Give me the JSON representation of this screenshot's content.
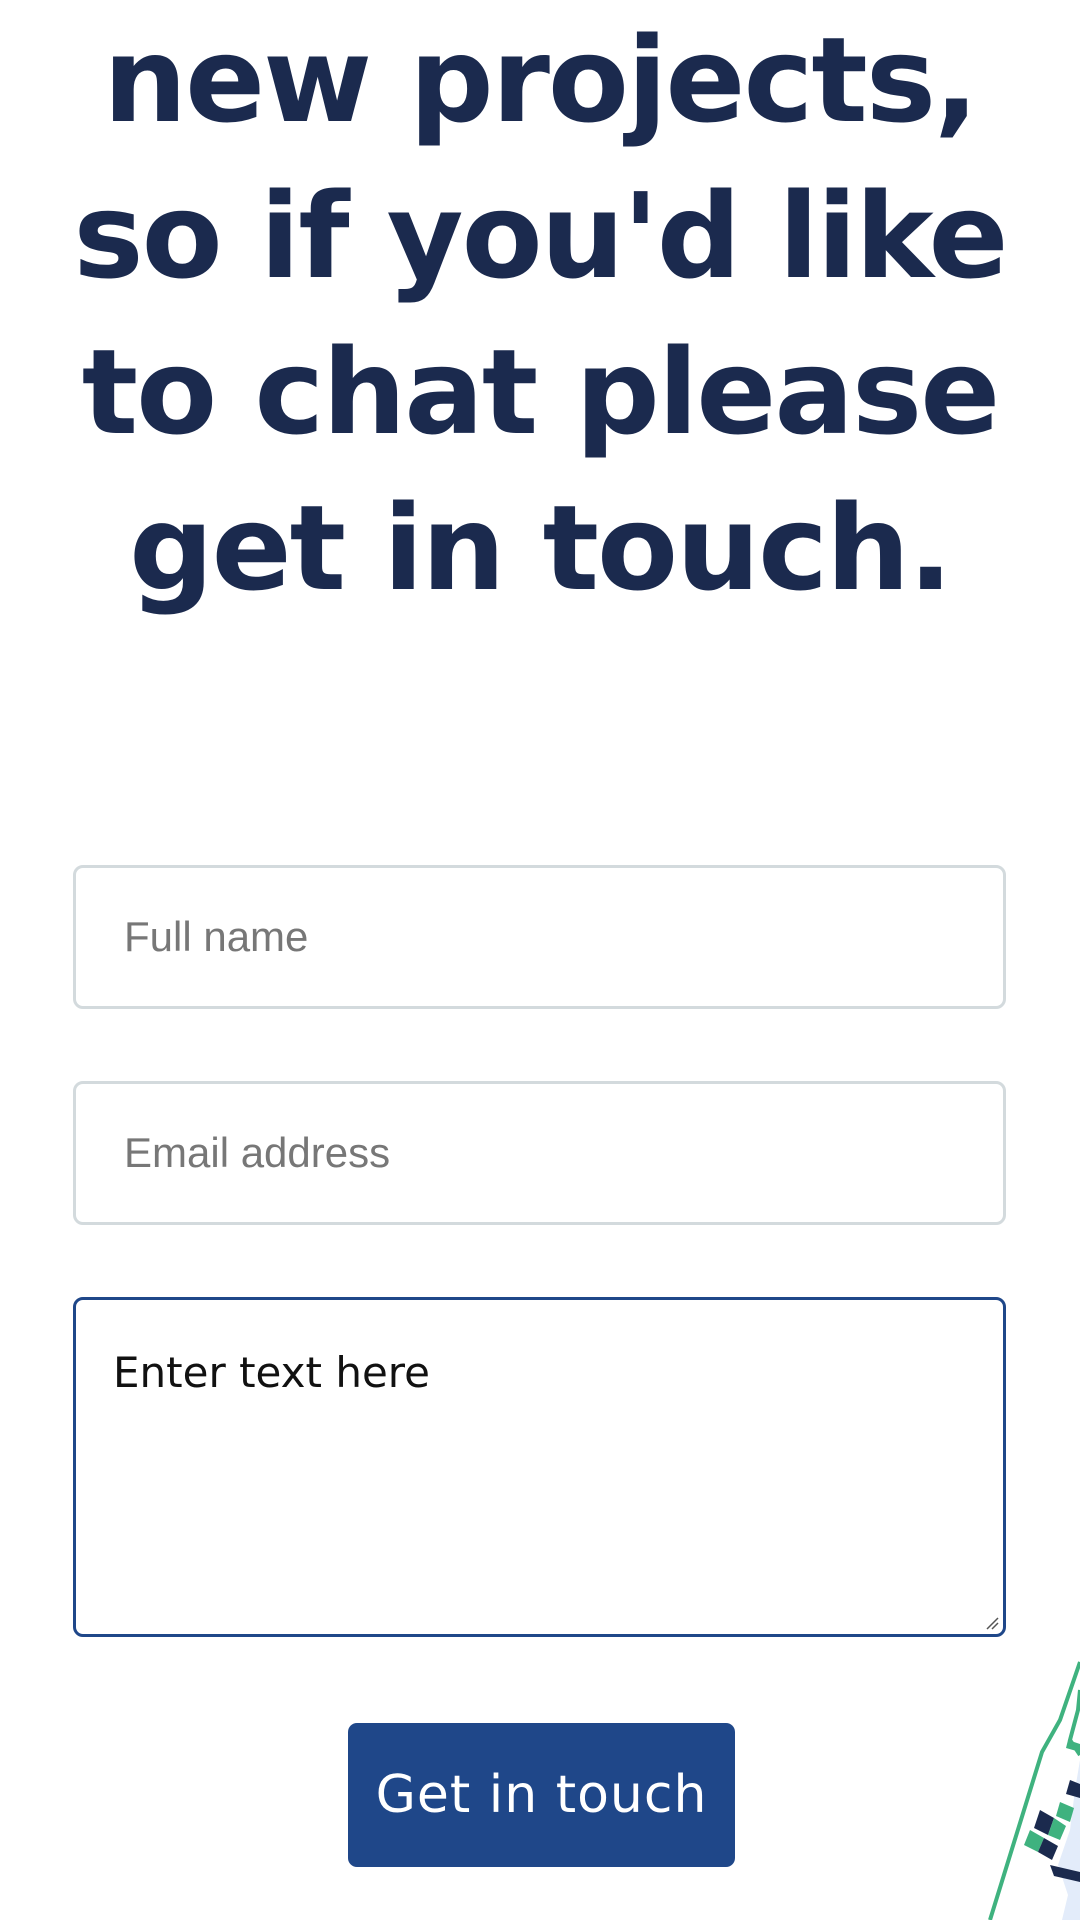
{
  "headline": {
    "line1": "new projects,",
    "line2": "so if you'd like",
    "line3": "to chat please",
    "line4": "get in touch."
  },
  "form": {
    "name_placeholder": "Full name",
    "email_placeholder": "Email address",
    "message_text": "Enter text here",
    "submit_label": "Get in touch"
  },
  "colors": {
    "heading": "#1b2a4e",
    "accent": "#1f4789",
    "field_border": "#d3dadd",
    "deco_green": "#3fb27f"
  }
}
